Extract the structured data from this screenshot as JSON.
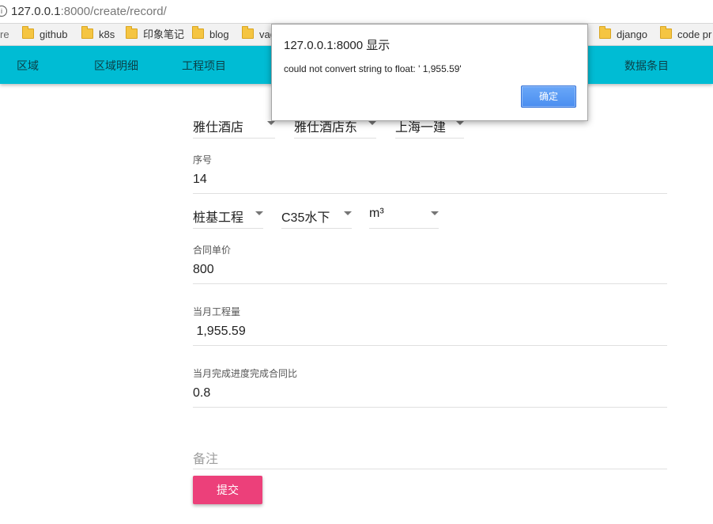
{
  "browser": {
    "url_host": "127.0.0.1",
    "url_path": ":8000/create/record/",
    "bookmarks_partial": "re",
    "bookmarks": [
      "github",
      "k8s",
      "印象笔记",
      "blog",
      "vag",
      "django",
      "code pr"
    ]
  },
  "nav": {
    "items": [
      "区域",
      "区域明细",
      "工程项目",
      "数据条目"
    ]
  },
  "form": {
    "row1": [
      "雅仕酒店",
      "雅仕酒店东",
      "上海一建"
    ],
    "seq_label": "序号",
    "seq_value": "14",
    "row2": [
      "桩基工程",
      "C35水下",
      "m³"
    ],
    "price_label": "合同单价",
    "price_value": "800",
    "quantity_label": "当月工程量",
    "quantity_value": " 1,955.59",
    "progress_label": "当月完成进度完成合同比",
    "progress_value": "0.8",
    "remark_placeholder": "备注",
    "submit_label": "提交"
  },
  "dialog": {
    "title": "127.0.0.1:8000 显示",
    "message": "could not convert string to float: ' 1,955.59'",
    "ok_label": "确定"
  },
  "colors": {
    "nav": "#00bcd4",
    "submit": "#ec407a",
    "dialog_button": "#4a8ef0"
  }
}
